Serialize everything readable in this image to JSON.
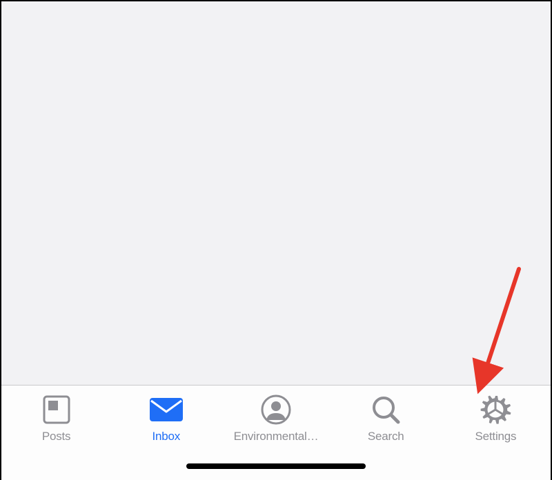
{
  "tabs": [
    {
      "id": "posts",
      "label": "Posts",
      "icon": "posts-icon",
      "active": false
    },
    {
      "id": "inbox",
      "label": "Inbox",
      "icon": "inbox-icon",
      "active": true
    },
    {
      "id": "environmental",
      "label": "Environmental…",
      "icon": "person-icon",
      "active": false
    },
    {
      "id": "search",
      "label": "Search",
      "icon": "search-icon",
      "active": false
    },
    {
      "id": "settings",
      "label": "Settings",
      "icon": "settings-icon",
      "active": false
    }
  ],
  "colors": {
    "active": "#1f6ef6",
    "inactive": "#8e8e93",
    "content_bg": "#f2f2f4",
    "tabbar_bg": "#fdfdfd",
    "annotation": "#e73629"
  },
  "annotation": {
    "target_tab": "settings",
    "type": "arrow"
  }
}
